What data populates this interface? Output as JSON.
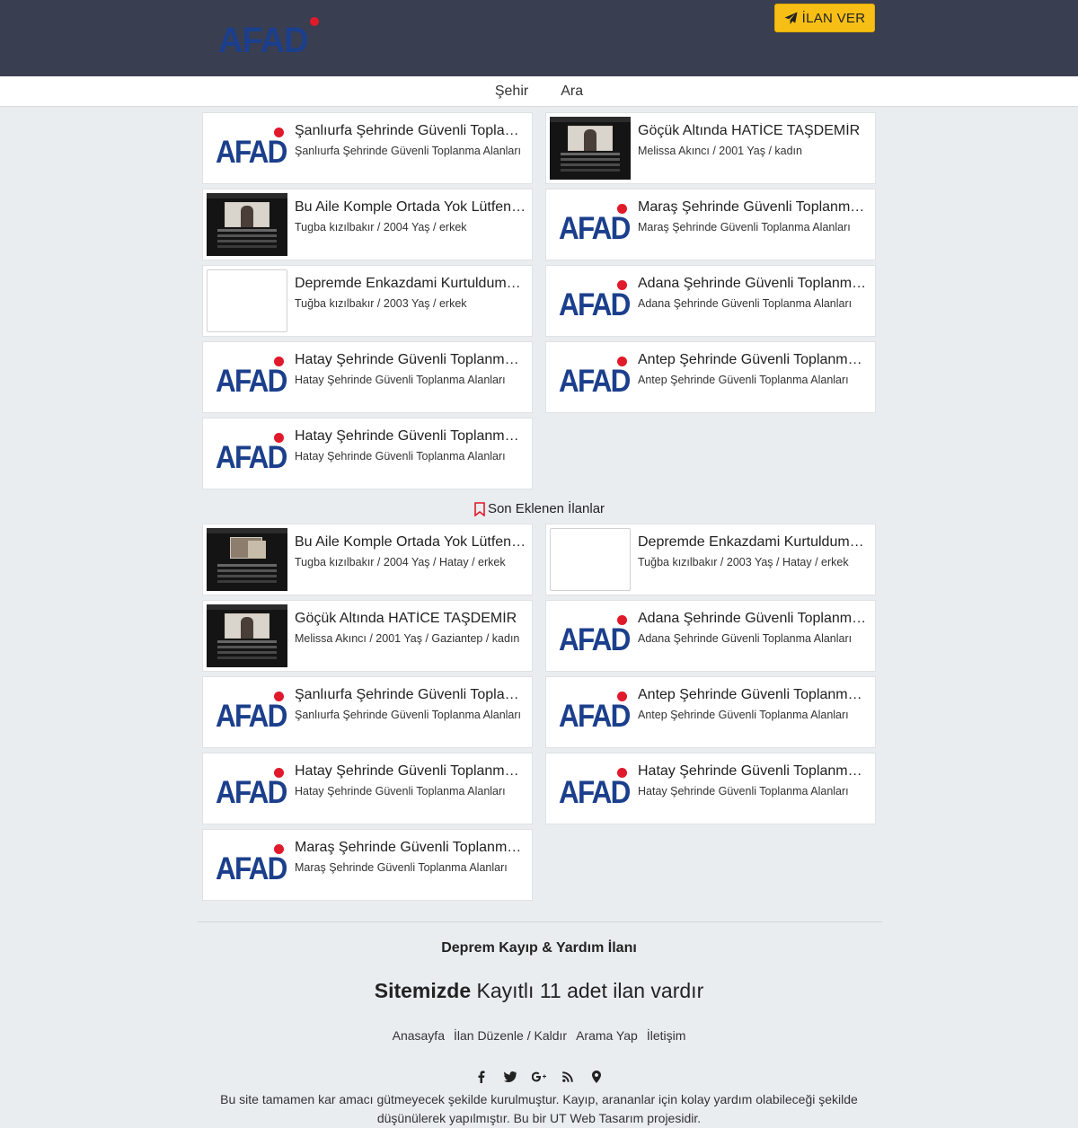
{
  "header": {
    "logo_text": "AFAD",
    "post_button_label": "İLAN VER",
    "post_button_icon": "paper-plane-icon",
    "accent": "#f7bf16",
    "bar_color": "#3a3e51"
  },
  "nav": {
    "items": [
      "Şehir",
      "Ara"
    ]
  },
  "featured": [
    {
      "title": "Şanlıurfa Şehrinde Güvenli Toplanma Alanları",
      "sub": "Şanlıurfa Şehrinde Güvenli Toplanma Alanları",
      "thumb": "afad-logo"
    },
    {
      "title": "Göçük Altında HATİCE TAŞDEMİR",
      "sub": "Melissa Akıncı / 2001 Yaş / kadın",
      "thumb": "photo"
    },
    {
      "title": "Bu Aile Komple Ortada Yok Lütfennnn",
      "sub": "Tugba kızılbakır / 2004 Yaş / erkek",
      "thumb": "photo"
    },
    {
      "title": "Maraş Şehrinde Güvenli Toplanma Alanları",
      "sub": "Maraş Şehrinde Güvenli Toplanma Alanları",
      "thumb": "afad-logo"
    },
    {
      "title": "Depremde Enkazdami Kurtuldumu Bilgi Lütfen",
      "sub": "Tuğba kızılbakır / 2003 Yaş / erkek",
      "thumb": "blank"
    },
    {
      "title": "Adana Şehrinde Güvenli Toplanma Alanları",
      "sub": "Adana Şehrinde Güvenli Toplanma Alanları",
      "thumb": "afad-logo"
    },
    {
      "title": "Hatay Şehrinde Güvenli Toplanma Alanları",
      "sub": "Hatay Şehrinde Güvenli Toplanma Alanları",
      "thumb": "afad-logo"
    },
    {
      "title": "Antep Şehrinde Güvenli Toplanma Alanları",
      "sub": "Antep Şehrinde Güvenli Toplanma Alanları",
      "thumb": "afad-logo"
    },
    {
      "title": "Hatay Şehrinde Güvenli Toplanma Alanları",
      "sub": "Hatay Şehrinde Güvenli Toplanma Alanları",
      "thumb": "afad-logo"
    }
  ],
  "recent_section_title": "Son Eklenen İlanlar",
  "recent": [
    {
      "title": "Bu Aile Komple Ortada Yok Lütfennnn",
      "sub": "Tugba kızılbakır / 2004 Yaş / Hatay / erkek",
      "thumb": "photo"
    },
    {
      "title": "Depremde Enkazdami Kurtuldumu Bilgi Lütfen",
      "sub": "Tuğba kızılbakır / 2003 Yaş / Hatay / erkek",
      "thumb": "blank"
    },
    {
      "title": "Göçük Altında HATİCE TAŞDEMİR",
      "sub": "Melissa Akıncı / 2001 Yaş / Gaziantep / kadın",
      "thumb": "photo"
    },
    {
      "title": "Adana Şehrinde Güvenli Toplanma Alanları",
      "sub": "Adana Şehrinde Güvenli Toplanma Alanları",
      "thumb": "afad-logo"
    },
    {
      "title": "Şanlıurfa Şehrinde Güvenli Toplanma Alanları",
      "sub": "Şanlıurfa Şehrinde Güvenli Toplanma Alanları",
      "thumb": "afad-logo"
    },
    {
      "title": "Antep Şehrinde Güvenli Toplanma Alanları",
      "sub": "Antep Şehrinde Güvenli Toplanma Alanları",
      "thumb": "afad-logo"
    },
    {
      "title": "Hatay Şehrinde Güvenli Toplanma Alanları",
      "sub": "Hatay Şehrinde Güvenli Toplanma Alanları",
      "thumb": "afad-logo"
    },
    {
      "title": "Hatay Şehrinde Güvenli Toplanma Alanları",
      "sub": "Hatay Şehrinde Güvenli Toplanma Alanları",
      "thumb": "afad-logo"
    },
    {
      "title": "Maraş Şehrinde Güvenli Toplanma Alanları",
      "sub": "Maraş Şehrinde Güvenli Toplanma Alanları",
      "thumb": "afad-logo"
    }
  ],
  "footer": {
    "title": "Deprem Kayıp & Yardım İlanı",
    "count_bold": "Sitemizde",
    "count_rest": "Kayıtlı 11 adet ilan vardır",
    "links": [
      "Anasayfa",
      "İlan Düzenle / Kaldır",
      "Arama Yap",
      "İletişim"
    ],
    "social_icons": [
      "facebook-icon",
      "twitter-icon",
      "google-plus-icon",
      "rss-icon",
      "map-marker-icon"
    ],
    "note": "Bu site tamamen kar amacı gütmeyecek şekilde kurulmuştur. Kayıp, arananlar için kolay yardım olabileceği şekilde düşünülerek yapılmıştır. Bu bir UT Web Tasarım projesidir."
  }
}
